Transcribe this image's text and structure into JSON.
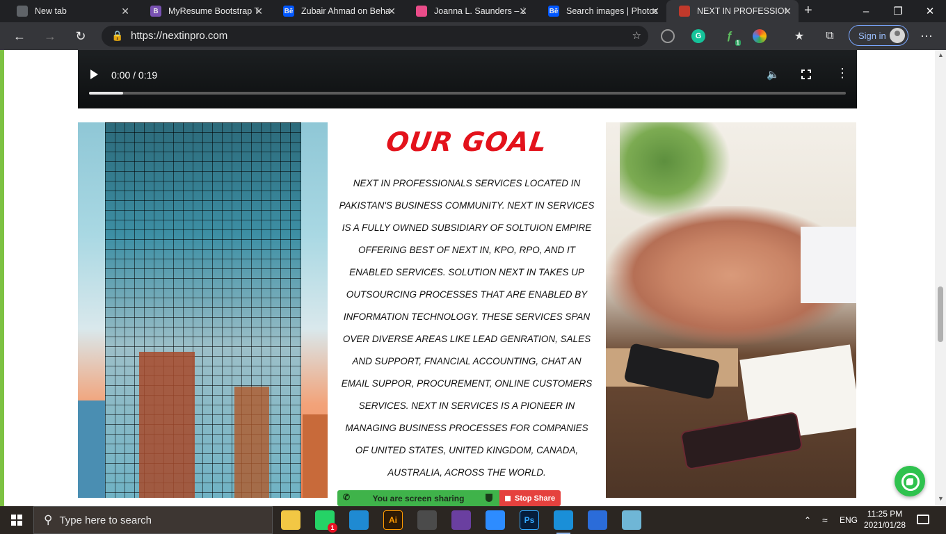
{
  "browser": {
    "tabs": [
      {
        "title": "New tab",
        "favicon": "new-tab-icon",
        "fav_text": "",
        "fav_color": "#5f6368"
      },
      {
        "title": "MyResume Bootstrap Te",
        "favicon": "bootstrap-icon",
        "fav_text": "B",
        "fav_color": "#7952b3"
      },
      {
        "title": "Zubair Ahmad on Beha",
        "favicon": "behance-icon",
        "fav_text": "Bē",
        "fav_color": "#0057ff"
      },
      {
        "title": "Joanna L. Saunders – Ju",
        "favicon": "dribbble-icon",
        "fav_text": "",
        "fav_color": "#ea4c89"
      },
      {
        "title": "Search images | Photos",
        "favicon": "behance-icon",
        "fav_text": "Bē",
        "fav_color": "#0057ff"
      },
      {
        "title": "NEXT IN PROFESSIONAL",
        "favicon": "site-icon",
        "fav_text": "",
        "fav_color": "#c0392b"
      }
    ],
    "active_tab": 5,
    "url": "https://nextinpro.com",
    "sign_in_label": "Sign in",
    "extension_badge": "1"
  },
  "video": {
    "time": "0:00 / 0:19",
    "progress": 0.045
  },
  "goal": {
    "title": "OUR GOAL",
    "text": "NEXT IN PROFESSIONALS SERVICES LOCATED IN PAKISTAN'S BUSINESS COMMUNITY. NEXT IN SERVICES IS A FULLY OWNED SUBSIDIARY OF SOLTUION EMPIRE OFFERING BEST OF NEXT IN, KPO, RPO, AND IT ENABLED SERVICES. SOLUTION NEXT IN TAKES UP OUTSOURCING PROCESSES THAT ARE ENABLED BY INFORMATION TECHNOLOGY. THESE SERVICES SPAN OVER DIVERSE AREAS LIKE LEAD GENRATION, SALES AND SUPPORT, FNANCIAL ACCOUNTING, CHAT AN EMAIL SUPPOR, PROCUREMENT, ONLINE CUSTOMERS SERVICES.  NEXT IN SERVICES IS A PIONEER IN MANAGING BUSINESS PROCESSES FOR COMPANIES OF UNITED STATES, UNITED KINGDOM, CANADA, AUSTRALIA, ACROSS THE WORLD.",
    "title_color": "#e3121b"
  },
  "screen_share": {
    "status": "You are screen sharing",
    "stop_label": "Stop Share"
  },
  "taskbar": {
    "search_placeholder": "Type here to search",
    "whatsapp_badge": "1",
    "language": "ENG",
    "time": "11:25 PM",
    "date": "2021/01/28",
    "apps": [
      {
        "name": "file-explorer-icon",
        "label": "",
        "color": "#f2c744"
      },
      {
        "name": "whatsapp-icon",
        "label": "",
        "color": "#25d366"
      },
      {
        "name": "vscode-icon",
        "label": "",
        "color": "#1f8ad2"
      },
      {
        "name": "illustrator-icon",
        "label": "Ai",
        "color": "#2e1a05"
      },
      {
        "name": "sublime-icon",
        "label": "",
        "color": "#4b4b4b"
      },
      {
        "name": "visual-studio-icon",
        "label": "",
        "color": "#6a3fa0"
      },
      {
        "name": "zoom-icon",
        "label": "",
        "color": "#2d8cff"
      },
      {
        "name": "photoshop-icon",
        "label": "Ps",
        "color": "#061e3c"
      },
      {
        "name": "edge-icon",
        "label": "",
        "color": "#1a8fd8"
      },
      {
        "name": "wps-icon",
        "label": "",
        "color": "#2b6cd9"
      },
      {
        "name": "notepad-icon",
        "label": "",
        "color": "#6fb6d6"
      }
    ]
  }
}
